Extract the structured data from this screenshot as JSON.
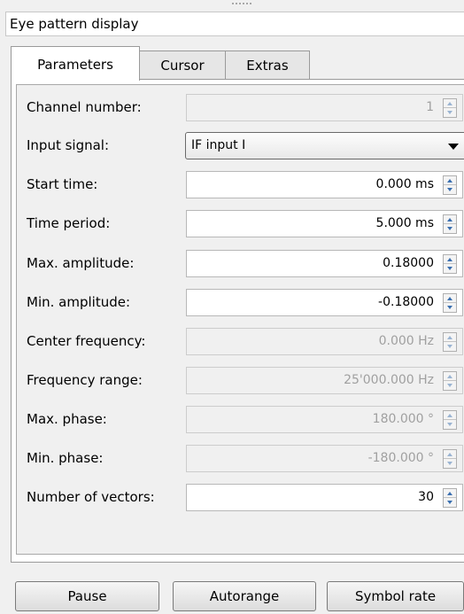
{
  "window": {
    "title": "Eye pattern display"
  },
  "tabs": [
    {
      "label": "Parameters",
      "active": true
    },
    {
      "label": "Cursor",
      "active": false
    },
    {
      "label": "Extras",
      "active": false
    }
  ],
  "params": [
    {
      "label": "Channel number:",
      "value": "1",
      "enabled": false,
      "kind": "spin"
    },
    {
      "label": "Input signal:",
      "value": "IF input I",
      "enabled": true,
      "kind": "combo"
    },
    {
      "label": "Start time:",
      "value": "0.000 ms",
      "enabled": true,
      "kind": "spin"
    },
    {
      "label": "Time period:",
      "value": "5.000 ms",
      "enabled": true,
      "kind": "spin"
    },
    {
      "label": "Max. amplitude:",
      "value": "0.18000",
      "enabled": true,
      "kind": "spin"
    },
    {
      "label": "Min. amplitude:",
      "value": "-0.18000",
      "enabled": true,
      "kind": "spin"
    },
    {
      "label": "Center frequency:",
      "value": "0.000 Hz",
      "enabled": false,
      "kind": "spin"
    },
    {
      "label": "Frequency range:",
      "value": "25'000.000 Hz",
      "enabled": false,
      "kind": "spin"
    },
    {
      "label": "Max. phase:",
      "value": "180.000 °",
      "enabled": false,
      "kind": "spin"
    },
    {
      "label": "Min. phase:",
      "value": "-180.000 °",
      "enabled": false,
      "kind": "spin"
    },
    {
      "label": "Number of vectors:",
      "value": "30",
      "enabled": true,
      "kind": "spin"
    }
  ],
  "buttons": {
    "pause": "Pause",
    "autorange": "Autorange",
    "symbol_rate": "Symbol rate"
  }
}
